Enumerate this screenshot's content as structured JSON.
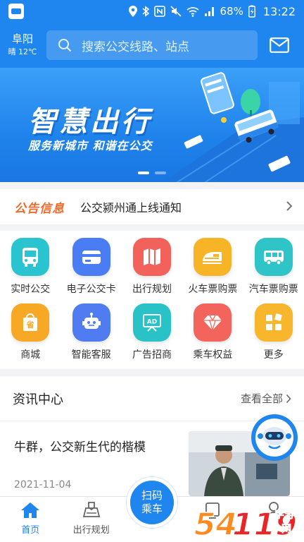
{
  "status_bar": {
    "battery": "68%",
    "time": "13:22"
  },
  "header": {
    "city": "阜阳",
    "weather": "晴 12℃",
    "search_placeholder": "搜索公交线路、站点"
  },
  "banner": {
    "title": "智慧出行",
    "subtitle": "服务新城市 和谐在公交"
  },
  "notice": {
    "tag": "公告信息",
    "text": "公交颍州通上线通知"
  },
  "services": [
    {
      "label": "实时公交",
      "icon": "bus-icon",
      "color": "#29c4cf"
    },
    {
      "label": "电子公交卡",
      "icon": "card-icon",
      "color": "#4a7df3"
    },
    {
      "label": "出行规划",
      "icon": "map-icon",
      "color": "#f2625a"
    },
    {
      "label": "火车票购票",
      "icon": "train-icon",
      "color": "#f7b427"
    },
    {
      "label": "汽车票购票",
      "icon": "coach-icon",
      "color": "#2fc4c8"
    },
    {
      "label": "商城",
      "icon": "shopping-bag-icon",
      "color": "#f7a824"
    },
    {
      "label": "智能客服",
      "icon": "robot-icon",
      "color": "#4f7cf0"
    },
    {
      "label": "广告招商",
      "icon": "ad-icon",
      "color": "#29c2c6"
    },
    {
      "label": "乘车权益",
      "icon": "diamond-icon",
      "color": "#f2645c"
    },
    {
      "label": "更多",
      "icon": "more-grid-icon",
      "color": "#f8b62c"
    }
  ],
  "news": {
    "title": "资讯中心",
    "more": "查看全部",
    "item_title": "牛群，公交新生代的楷模",
    "item_date": "2021-11-04"
  },
  "tabbar": {
    "home": "首页",
    "plan": "出行规划",
    "scan_line1": "扫码",
    "scan_line2": "乘车"
  },
  "watermark": "54119 手游网"
}
